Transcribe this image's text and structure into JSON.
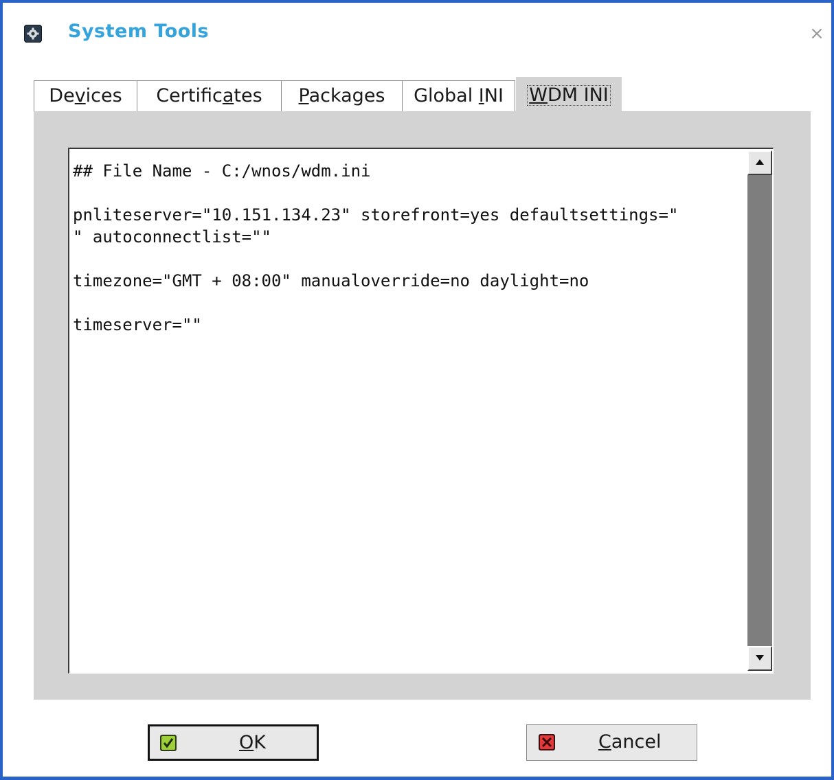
{
  "window": {
    "title": "System Tools",
    "close_glyph": "×",
    "app_icon": "gear-icon"
  },
  "tabs": [
    {
      "label_pre": "De",
      "label_u": "v",
      "label_post": "ices",
      "active": false
    },
    {
      "label_pre": "Certific",
      "label_u": "a",
      "label_post": "tes",
      "active": false
    },
    {
      "label_pre": "",
      "label_u": "P",
      "label_post": "ackages",
      "active": false
    },
    {
      "label_pre": "Global ",
      "label_u": "I",
      "label_post": "NI",
      "active": false
    },
    {
      "label_pre": "",
      "label_u": "W",
      "label_post": "DM INI",
      "active": true
    }
  ],
  "editor": {
    "content": "## File Name - C:/wnos/wdm.ini\n\npnliteserver=\"10.151.134.23\" storefront=yes defaultsettings=\"\n\" autoconnectlist=\"\"\n\ntimezone=\"GMT + 08:00\" manualoverride=no daylight=no\n\ntimeserver=\"\""
  },
  "buttons": {
    "ok": {
      "u": "O",
      "rest": "K",
      "icon": "check-icon"
    },
    "cancel": {
      "u": "C",
      "rest": "ancel",
      "icon": "x-icon"
    }
  },
  "colors": {
    "window_border": "#2a63c8",
    "title": "#35a3dc",
    "panel": "#d3d3d3",
    "scrollbar": "#7e7e7e"
  }
}
